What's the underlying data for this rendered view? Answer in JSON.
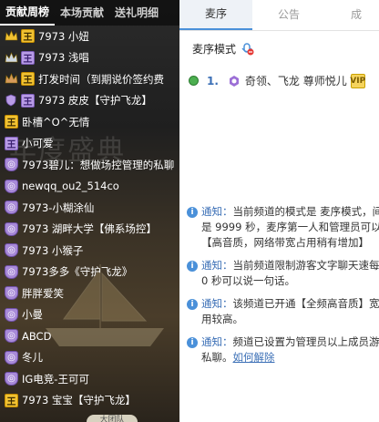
{
  "left_tabs": [
    "贡献周榜",
    "本场贡献",
    "送礼明细"
  ],
  "background_text": "年度盛典",
  "contributors": [
    {
      "rank_icon": "crown-gold-icon",
      "badge": "gold",
      "badge_icon": "level-badge-icon",
      "name": "7973 小妞"
    },
    {
      "rank_icon": "crown-silver-icon",
      "badge": "purple",
      "badge_icon": "level-badge-icon",
      "name": "7973 浅唱"
    },
    {
      "rank_icon": "crown-bronze-icon",
      "badge": "gold",
      "badge_icon": "level-badge-icon",
      "name": "打发时间（到期说价签约费"
    },
    {
      "rank_icon": "shield-icon",
      "badge": "purple",
      "badge_icon": "level-badge-icon",
      "name": "7973 皮皮【守护飞龙】"
    },
    {
      "rank_icon": "",
      "badge": "gold",
      "badge_icon": "level-badge-icon",
      "name": "卧槽^O^无情"
    },
    {
      "rank_icon": "",
      "badge": "purple",
      "badge_icon": "level-badge-icon",
      "name": "小可爱"
    },
    {
      "rank_icon": "",
      "badge": "shield",
      "badge_icon": "shield-icon",
      "name": "7973碧儿：想做场控管理的私聊"
    },
    {
      "rank_icon": "",
      "badge": "shield",
      "badge_icon": "shield-icon",
      "name": "newqq_ou2_514co"
    },
    {
      "rank_icon": "",
      "badge": "shield",
      "badge_icon": "shield-icon",
      "name": "7973-小糊涂仙"
    },
    {
      "rank_icon": "",
      "badge": "shield",
      "badge_icon": "shield-icon",
      "name": "7973 湖畔大学【佛系场控】"
    },
    {
      "rank_icon": "",
      "badge": "shield",
      "badge_icon": "shield-icon",
      "name": "7973 小猴子"
    },
    {
      "rank_icon": "",
      "badge": "shield",
      "badge_icon": "shield-icon",
      "name": "7973多多《守护飞龙》"
    },
    {
      "rank_icon": "",
      "badge": "shield",
      "badge_icon": "shield-icon",
      "name": "胖胖爱笑"
    },
    {
      "rank_icon": "",
      "badge": "shield",
      "badge_icon": "shield-icon",
      "name": "小曼"
    },
    {
      "rank_icon": "",
      "badge": "shield",
      "badge_icon": "shield-icon",
      "name": "ABCD"
    },
    {
      "rank_icon": "",
      "badge": "shield",
      "badge_icon": "shield-icon",
      "name": "冬儿"
    },
    {
      "rank_icon": "",
      "badge": "shield",
      "badge_icon": "shield-icon",
      "name": "IG电竞-王可可"
    },
    {
      "rank_icon": "",
      "badge": "gold",
      "badge_icon": "level-badge-icon",
      "name": "7973 宝宝【守护飞龙】"
    }
  ],
  "bottom_tag": "大团队",
  "right_tabs": [
    "麦序",
    "公告",
    "成"
  ],
  "mode_label": "麦序模式",
  "queue": {
    "index": "1.",
    "name": "奇领、飞龙 尊师悦儿",
    "badge": "VIP"
  },
  "notices": [
    {
      "label": "通知：",
      "text": "当前频道的模式是 麦序模式，间是 9999 秒，麦序第一人和管理员可以【高音质，网络带宽占用稍有增加】"
    },
    {
      "label": "通知：",
      "text": "当前频道限制游客文字聊天速每隔 0 秒可以说一句话。"
    },
    {
      "label": "通知：",
      "text": "该频道已开通【全频高音质】宽占用较高。"
    },
    {
      "label": "通知：",
      "text": "频道已设置为管理员以上成员游客私聊。",
      "link": "如何解除"
    }
  ],
  "colors": {
    "accent": "#4a90d9",
    "gold": "#f1c232",
    "purple": "#b89be6"
  }
}
